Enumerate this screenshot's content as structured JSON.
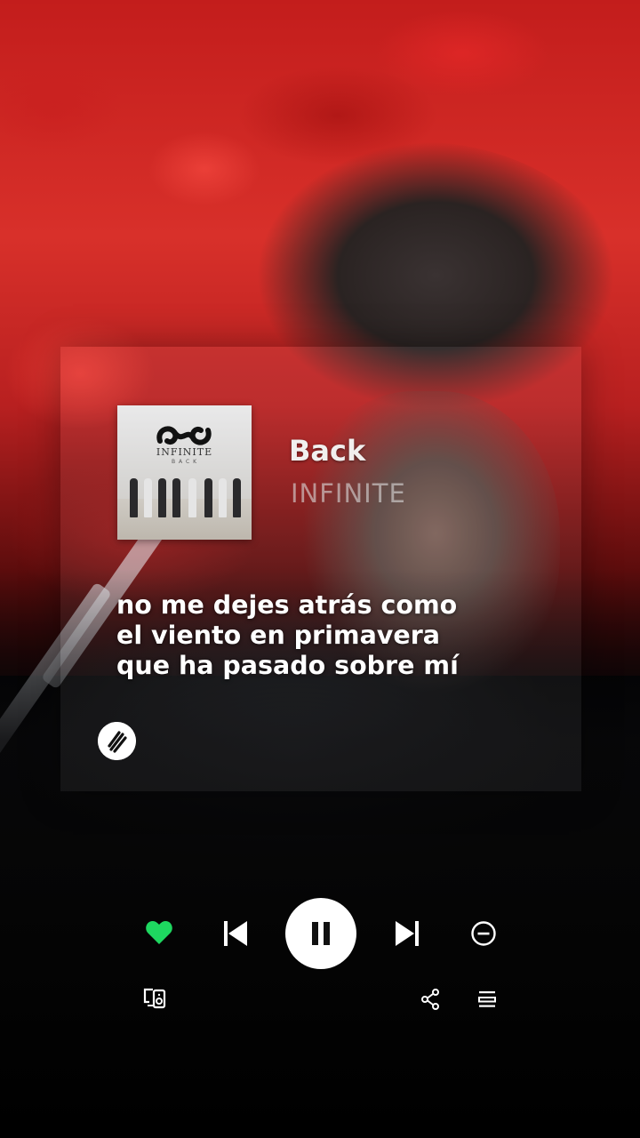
{
  "track": {
    "title": "Back",
    "artist": "INFINITE"
  },
  "album_cover": {
    "brand_text": "INFINITE",
    "subtitle_text": "B  A  C  K"
  },
  "lyrics": [
    "no me dejes atrás como",
    "el viento en primavera",
    "que ha pasado sobre mí"
  ],
  "controls": {
    "liked": true,
    "playing": true
  },
  "colors": {
    "accent_green": "#1ed760",
    "background_red": "#c31d1c"
  },
  "icons": [
    "heart-icon",
    "skip-previous-icon",
    "pause-icon",
    "skip-next-icon",
    "remove-icon",
    "connect-device-icon",
    "share-icon",
    "queue-icon",
    "spotify-logo"
  ]
}
